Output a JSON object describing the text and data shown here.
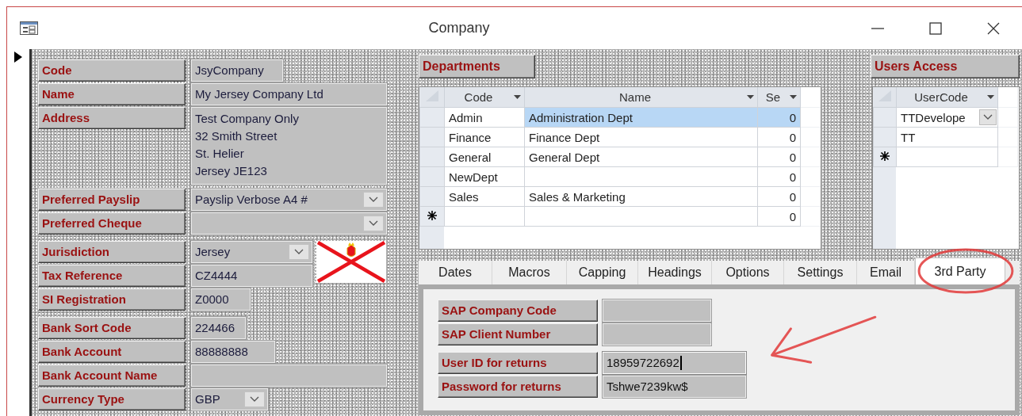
{
  "window": {
    "title": "Company"
  },
  "field_groups": [
    [
      {
        "label": "Code",
        "kind": "text",
        "value": "JsyCompany"
      },
      {
        "label": "Name",
        "kind": "text",
        "value": "My Jersey Company Ltd"
      },
      {
        "label": "Address",
        "kind": "multiline",
        "lines": [
          "Test Company Only",
          "32 Smith Street",
          "St. Helier",
          "Jersey JE123"
        ]
      }
    ],
    [
      {
        "label": "Preferred Payslip",
        "kind": "combo",
        "value": "Payslip Verbose A4 #"
      },
      {
        "label": "Preferred Cheque",
        "kind": "combo"
      }
    ],
    [
      {
        "label": "Jurisdiction",
        "kind": "combo",
        "value": "Jersey"
      },
      {
        "label": "Tax Reference",
        "kind": "text",
        "value": "CZ4444"
      },
      {
        "label": "SI Registration",
        "kind": "text",
        "value": "Z0000"
      }
    ],
    [
      {
        "label": "Bank Sort Code",
        "kind": "text",
        "value": "224466"
      },
      {
        "label": "Bank Account",
        "kind": "text",
        "value": "88888888"
      },
      {
        "label": "Bank Account Name",
        "kind": "text"
      },
      {
        "label": "Currency Type",
        "kind": "combo",
        "value": "GBP"
      }
    ]
  ],
  "departments": {
    "title": "Departments",
    "columns": [
      "Code",
      "Name",
      "Se"
    ],
    "rows": [
      {
        "kind": "record",
        "cells": [
          "Admin",
          "Administration Dept",
          "0"
        ],
        "selected": true
      },
      {
        "kind": "record",
        "cells": [
          "Finance",
          "Finance Dept",
          "0"
        ],
        "selected": false
      },
      {
        "kind": "record",
        "cells": [
          "General",
          "General Dept",
          "0"
        ],
        "selected": false
      },
      {
        "kind": "record",
        "cells": [
          "NewDept",
          null,
          "0"
        ],
        "selected": false
      },
      {
        "kind": "record",
        "cells": [
          "Sales",
          "Sales & Marketing",
          "0"
        ],
        "selected": false
      },
      {
        "kind": "new",
        "cells": [
          null,
          null,
          "0"
        ],
        "selected": false
      }
    ]
  },
  "users_access": {
    "title": "Users Access",
    "columns": [
      "UserCode"
    ],
    "rows": [
      {
        "kind": "record",
        "cells": [
          "TTDevelope"
        ],
        "selected": true
      },
      {
        "kind": "record",
        "cells": [
          "TT"
        ],
        "selected": false
      },
      {
        "kind": "new",
        "cells": [
          null
        ],
        "selected": false
      }
    ]
  },
  "tabs": [
    {
      "label": "Dates",
      "selected": false
    },
    {
      "label": "Macros",
      "selected": false
    },
    {
      "label": "Capping",
      "selected": false
    },
    {
      "label": "Headings",
      "selected": false
    },
    {
      "label": "Options",
      "selected": false
    },
    {
      "label": "Settings",
      "selected": false
    },
    {
      "label": "Email",
      "selected": false
    },
    {
      "label": "3rd Party",
      "selected": true
    }
  ],
  "tab_page": {
    "field_groups": [
      [
        {
          "label": "SAP Company Code",
          "kind": "text",
          "focused": false
        },
        {
          "label": "SAP Client Number",
          "kind": "text",
          "focused": false
        }
      ],
      [
        {
          "label": "User ID for returns",
          "kind": "text",
          "value": "18959722692",
          "focused": true
        },
        {
          "label": "Password for returns",
          "kind": "text",
          "value": "Tshwe7239kw$",
          "focused": false
        }
      ]
    ]
  },
  "annotations": [
    {
      "kind": "circle"
    },
    {
      "kind": "arrow"
    }
  ]
}
